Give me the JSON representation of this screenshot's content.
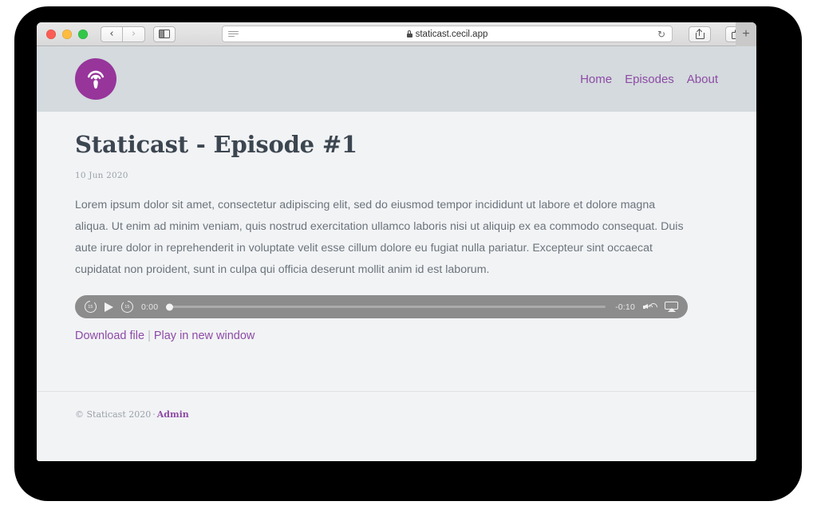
{
  "browser": {
    "traffic_lights": [
      "close",
      "minimize",
      "zoom"
    ],
    "back_label": "‹",
    "forward_label": "›",
    "sidebar_icon": "sidebar-toggle-icon",
    "reader_icon": "reader-view-icon",
    "lock_icon": "lock-icon",
    "url": "staticast.cecil.app",
    "reload_label": "↻",
    "share_icon": "share-icon",
    "tabs_icon": "show-tabs-icon",
    "new_tab_label": "+"
  },
  "site": {
    "logo_icon": "podcast-icon",
    "logo_color": "#97359b",
    "accent_color": "#8d4ba6",
    "header_bg": "#d4dadd",
    "nav": [
      {
        "label": "Home"
      },
      {
        "label": "Episodes"
      },
      {
        "label": "About"
      }
    ]
  },
  "post": {
    "title": "Staticast - Episode #1",
    "date": "10 Jun 2020",
    "body": "Lorem ipsum dolor sit amet, consectetur adipiscing elit, sed do eiusmod tempor incididunt ut labore et dolore magna aliqua. Ut enim ad minim veniam, quis nostrud exercitation ullamco laboris nisi ut aliquip ex ea commodo consequat. Duis aute irure dolor in reprehenderit in voluptate velit esse cillum dolore eu fugiat nulla pariatur. Excepteur sint occaecat cupidatat non proident, sunt in culpa qui officia deserunt mollit anim id est laborum."
  },
  "player": {
    "skip_back_label": "15",
    "play_icon": "play-icon",
    "skip_forward_label": "15",
    "current_time": "0:00",
    "remaining_time": "-0:10",
    "progress_percent": 0,
    "volume_icon": "volume-icon",
    "airplay_icon": "airplay-icon",
    "bar_color": "#8c8c8c"
  },
  "media_links": {
    "download_label": "Download file",
    "separator": "|",
    "play_new_window_label": "Play in new window"
  },
  "footer": {
    "copyright": "© Staticast 2020",
    "separator": "·",
    "admin_label": "Admin"
  }
}
